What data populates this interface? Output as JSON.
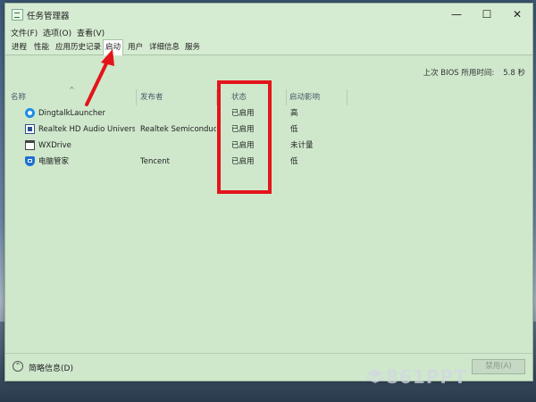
{
  "window": {
    "title": "任务管理器"
  },
  "menu": {
    "items": [
      "文件(F)",
      "选项(O)",
      "查看(V)"
    ]
  },
  "tabs": [
    "进程",
    "性能",
    "应用历史记录",
    "启动",
    "用户",
    "详细信息",
    "服务"
  ],
  "active_tab": "启动",
  "bios": {
    "label": "上次 BIOS 所用时间:",
    "value": "5.8 秒"
  },
  "table": {
    "columns": [
      "名称",
      "发布者",
      "状态",
      "启动影响"
    ],
    "rows": [
      {
        "icon": "dingtalk-icon",
        "name": "DingtalkLauncher",
        "publisher": "",
        "status": "已启用",
        "impact": "高"
      },
      {
        "icon": "speaker-icon",
        "name": "Realtek HD Audio Univers...",
        "publisher": "Realtek Semiconductor",
        "status": "已启用",
        "impact": "低"
      },
      {
        "icon": "window-icon",
        "name": "WXDrive",
        "publisher": "",
        "status": "已启用",
        "impact": "未计量"
      },
      {
        "icon": "shield-icon",
        "name": "电脑管家",
        "publisher": "Tencent",
        "status": "已启用",
        "impact": "低"
      }
    ]
  },
  "footer": {
    "fewer_details": "简略信息(D)",
    "disable": "禁用(A)"
  },
  "watermark": "861PPT",
  "annotation_color": "#e4141b"
}
